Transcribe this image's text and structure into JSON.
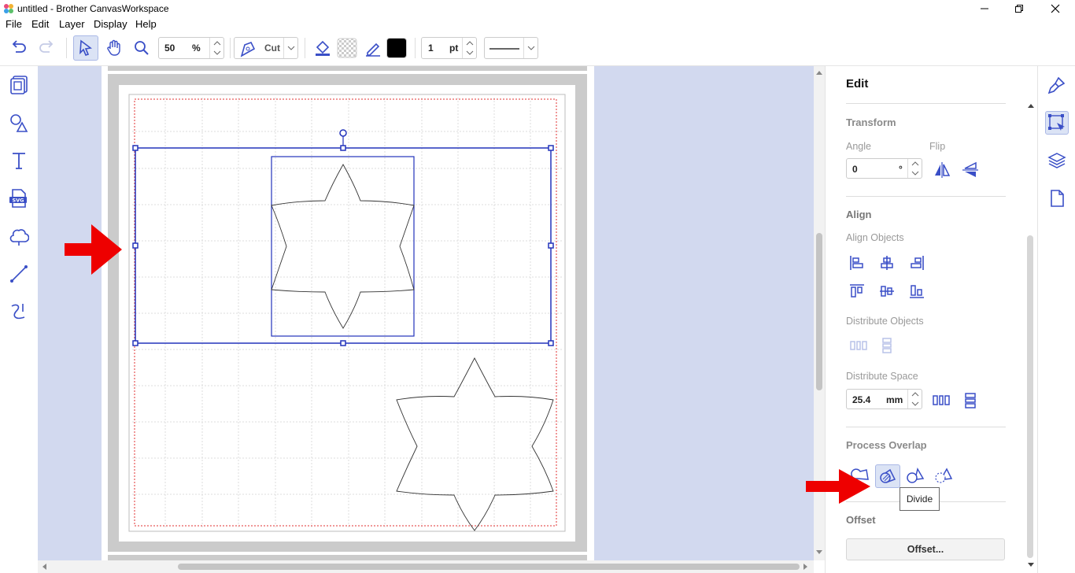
{
  "window": {
    "title": "untitled - Brother CanvasWorkspace"
  },
  "menu": {
    "items": [
      "File",
      "Edit",
      "Layer",
      "Display",
      "Help"
    ]
  },
  "toolbar": {
    "zoom_value": "50",
    "zoom_unit": "%",
    "mode_label": "Cut",
    "line_width_value": "1",
    "line_width_unit": "pt",
    "colors": {
      "line_color": "#000000",
      "accent": "#3a4fc7"
    }
  },
  "panel": {
    "title": "Edit",
    "transform": {
      "heading": "Transform",
      "angle_label": "Angle",
      "angle_value": "0",
      "angle_unit": "°",
      "flip_label": "Flip"
    },
    "align": {
      "heading": "Align",
      "align_objects_label": "Align Objects",
      "distribute_objects_label": "Distribute Objects",
      "distribute_space_label": "Distribute Space",
      "distribute_space_value": "25.4",
      "distribute_space_unit": "mm"
    },
    "process_overlap": {
      "heading": "Process Overlap",
      "tooltip": "Divide"
    },
    "offset": {
      "heading": "Offset",
      "button_label": "Offset..."
    }
  },
  "colors": {
    "selection": "#2233bb",
    "annotation_arrow": "#ee0000",
    "canvas_bg": "#d2d9ef"
  }
}
